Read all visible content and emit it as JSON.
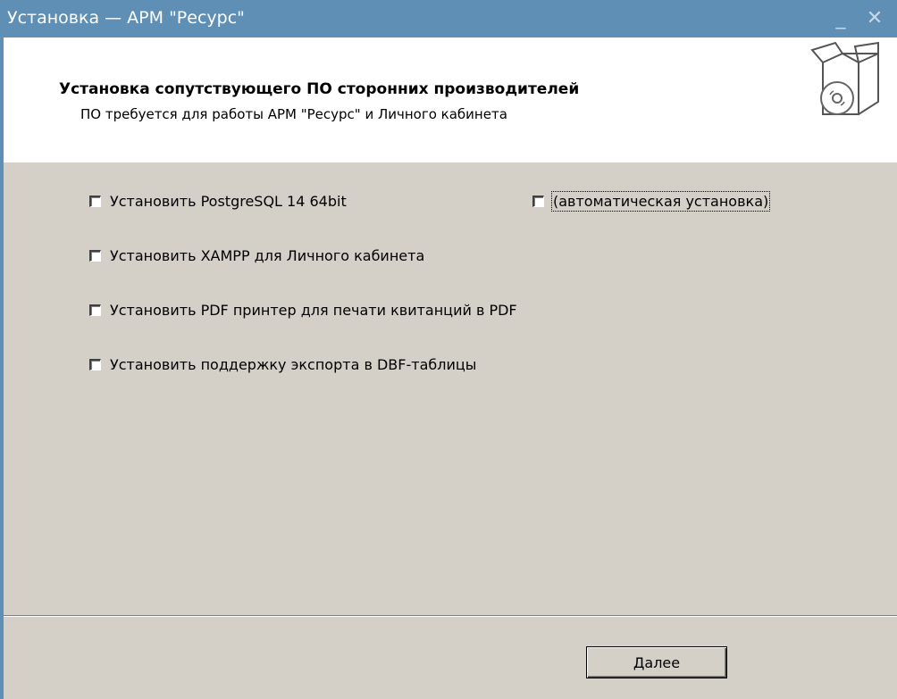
{
  "window": {
    "title": "Установка — АРМ \"Ресурс\"",
    "minimize_glyph": "_",
    "close_glyph": "✕",
    "titlebar_color": "#5f8fb5"
  },
  "header": {
    "title": "Установка сопутствующего ПО сторонних производителей",
    "subtitle": "ПО требуется для работы АРМ \"Ресурс\" и Личного кабинета",
    "icon": "box-with-disc-icon"
  },
  "options": [
    {
      "label": "Установить PostgreSQL 14 64bit",
      "checked": false
    },
    {
      "label": "(автоматическая установка)",
      "checked": false
    },
    {
      "label": "Установить XAMPP для Личного кабинета",
      "checked": false
    },
    {
      "label": "Установить PDF принтер для печати квитанций в PDF",
      "checked": false
    },
    {
      "label": "Установить поддержку экспорта в DBF-таблицы",
      "checked": false
    }
  ],
  "footer": {
    "next_button": {
      "accel": "Д",
      "rest": "алее"
    }
  }
}
